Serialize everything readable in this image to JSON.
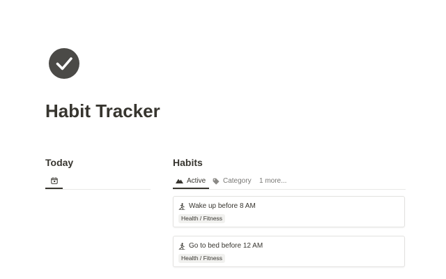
{
  "page": {
    "icon": "check-circle-icon",
    "title": "Habit Tracker"
  },
  "today": {
    "heading": "Today",
    "tabs": [
      {
        "icon": "calendar-icon",
        "label": ""
      }
    ]
  },
  "habits": {
    "heading": "Habits",
    "tabs": [
      {
        "icon": "mountain-icon",
        "label": "Active",
        "active": true
      },
      {
        "icon": "tag-icon",
        "label": "Category",
        "active": false
      }
    ],
    "more_label": "1 more...",
    "cards": [
      {
        "icon": "person-running-icon",
        "title": "Wake up before 8 AM",
        "tag": "Health / Fitness"
      },
      {
        "icon": "person-running-icon",
        "title": "Go to bed before 12 AM",
        "tag": "Health / Fitness"
      }
    ]
  },
  "colors": {
    "text": "#37352f",
    "muted": "#787774",
    "icon_fill": "#4b4a47",
    "tag_bg": "#f1f1ef",
    "border": "#e3e2e0"
  }
}
